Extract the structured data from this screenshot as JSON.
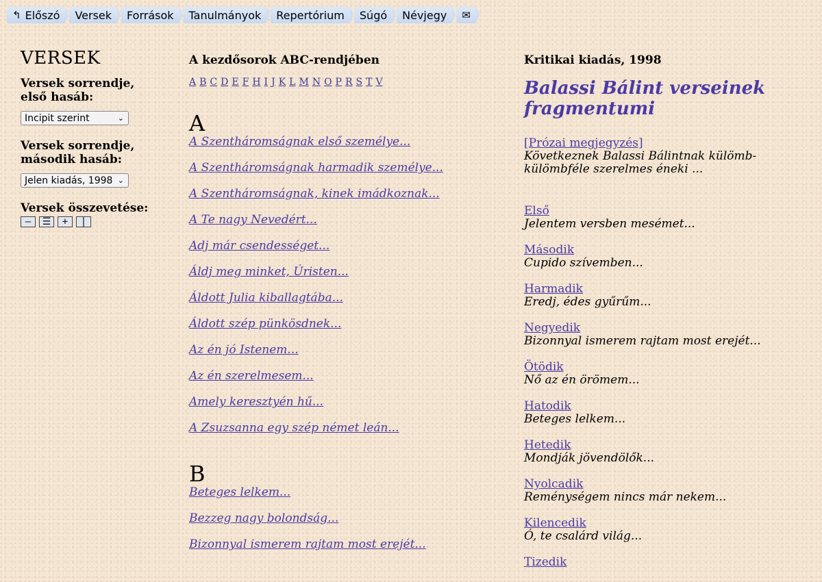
{
  "nav": {
    "items": [
      "Előszó",
      "Versek",
      "Források",
      "Tanulmányok",
      "Repertórium",
      "Súgó",
      "Névjegy"
    ],
    "first_icon": "arrow-icon",
    "mail_icon": "mail-icon"
  },
  "left": {
    "title": "VERSEK",
    "order_first_label": "Versek sorrendje, első hasáb:",
    "order_first_value": "Incipit szerint",
    "order_second_label": "Versek sorrendje, második hasáb:",
    "order_second_value": "Jelen kiadás, 1998",
    "compare_label": "Versek összevetése:",
    "compare_buttons": [
      "—",
      "☰",
      "+",
      "|"
    ]
  },
  "middle": {
    "heading": "A kezdősorok ABC-rendjében",
    "alphabet": [
      "A",
      "B",
      "C",
      "D",
      "E",
      "F",
      "H",
      "I",
      "J",
      "K",
      "L",
      "M",
      "N",
      "O",
      "P",
      "R",
      "S",
      "T",
      "V"
    ],
    "sections": [
      {
        "letter": "A",
        "poems": [
          "A Szentháromságnak első személye...",
          "A Szentháromságnak harmadik személye...",
          "A Szentháromságnak, kinek imádkoznak...",
          "A Te nagy Nevedért...",
          "Adj már csendességet...",
          "Áldj meg minket, Úristen...",
          "Áldott Julia kiballagtába...",
          "Áldott szép pünkösdnek...",
          "Az én jó Istenem...",
          "Az én szerelmesem...",
          "Amely keresztyén hű...",
          "A Zsuzsanna egy szép német leán..."
        ]
      },
      {
        "letter": "B",
        "poems": [
          "Beteges lelkem...",
          "Bezzeg nagy bolondság...",
          "Bizonnyal ismerem rajtam most erejét..."
        ]
      }
    ]
  },
  "right": {
    "heading": "Kritikai kiadás, 1998",
    "title": "Balassi Bálint verseinek fragmentumi",
    "prose_link": "[Prózai megjegyzés]",
    "prose_text": "Következnek Balassi Bálintnak külömb-külömbféle szerelmes éneki ...",
    "entries": [
      {
        "label": "Első",
        "incipit": "Jelentem versben mesémet..."
      },
      {
        "label": "Második",
        "incipit": "Cupido szívemben..."
      },
      {
        "label": "Harmadik",
        "incipit": "Eredj, édes gyűrűm..."
      },
      {
        "label": "Negyedik",
        "incipit": "Bizonnyal ismerem rajtam most erejét..."
      },
      {
        "label": "Ötödik",
        "incipit": "Nő az én örömem..."
      },
      {
        "label": "Hatodik",
        "incipit": "Beteges lelkem..."
      },
      {
        "label": "Hetedik",
        "incipit": "Mondják jövendölők..."
      },
      {
        "label": "Nyolcadik",
        "incipit": "Reménységem nincs már nekem..."
      },
      {
        "label": "Kilencedik",
        "incipit": "Ó, te csalárd világ..."
      },
      {
        "label": "Tizedik",
        "incipit": ""
      }
    ]
  }
}
